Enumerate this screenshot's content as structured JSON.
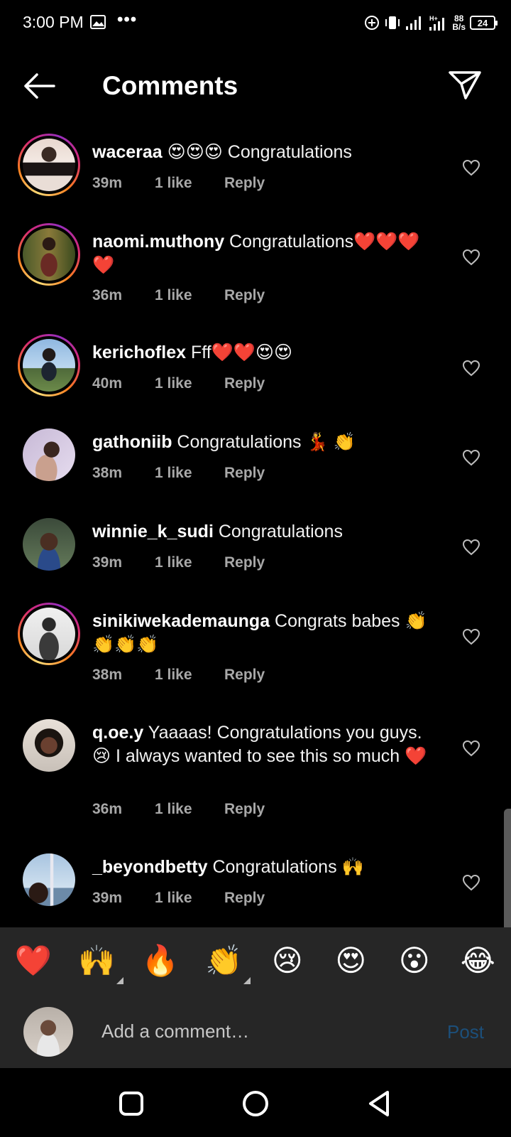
{
  "status_bar": {
    "time": "3:00 PM",
    "dots": "•••",
    "speed_value": "88",
    "speed_unit": "B/s",
    "battery": "24",
    "network": "H+"
  },
  "header": {
    "title": "Comments",
    "back_icon": "arrow-left-icon",
    "send_icon": "paper-plane-icon"
  },
  "comments": [
    {
      "username": "waceraa",
      "text": " 😍😍😍 Congratulations",
      "time": "39m",
      "likes": "1 like",
      "reply": "Reply",
      "story": true
    },
    {
      "username": "naomi.muthony",
      "text": " Congratulations❤️❤️❤️❤️",
      "time": "36m",
      "likes": "1 like",
      "reply": "Reply",
      "story": true
    },
    {
      "username": "kerichoflex",
      "text": " Fff❤️❤️😍😍",
      "time": "40m",
      "likes": "1 like",
      "reply": "Reply",
      "story": true
    },
    {
      "username": "gathoniib",
      "text": " Congratulations 💃 👏",
      "time": "38m",
      "likes": "1 like",
      "reply": "Reply",
      "story": false
    },
    {
      "username": "winnie_k_sudi",
      "text": " Congratulations",
      "time": "39m",
      "likes": "1 like",
      "reply": "Reply",
      "story": false
    },
    {
      "username": "sinikiwekademaunga",
      "text": " Congrats babes 👏👏👏👏",
      "time": "38m",
      "likes": "1 like",
      "reply": "Reply",
      "story": true
    },
    {
      "username": "q.oe.y",
      "text": " Yaaaas! Congratulations you guys. 😢 I always wanted to see this so much ❤️",
      "time": "36m",
      "likes": "1 like",
      "reply": "Reply",
      "story": false
    },
    {
      "username": "_beyondbetty",
      "text": " Congratulations 🙌",
      "time": "39m",
      "likes": "1 like",
      "reply": "Reply",
      "story": false
    }
  ],
  "emoji_bar": [
    "❤️",
    "🙌",
    "🔥",
    "👏",
    "😢",
    "😍",
    "😮",
    "😂"
  ],
  "composer": {
    "placeholder": "Add a comment…",
    "post_label": "Post"
  },
  "colors": {
    "background": "#000000",
    "panel": "#262626",
    "meta_text": "#a8a8a8",
    "post_disabled": "#1c4f7a"
  }
}
